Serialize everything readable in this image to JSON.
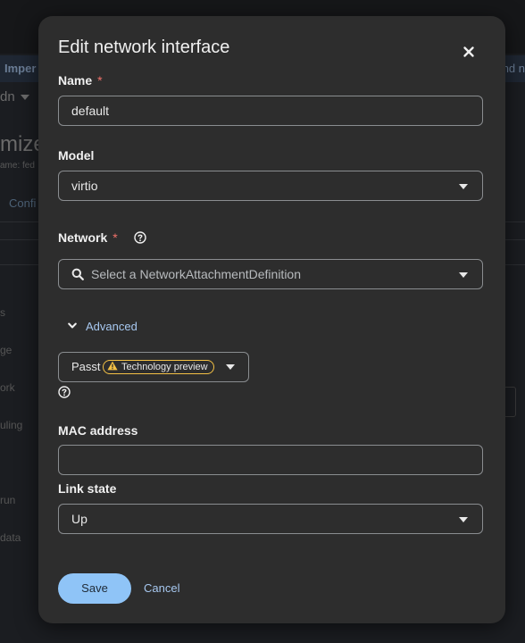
{
  "background": {
    "strip_left": "Imper",
    "strip_right": "nd n",
    "project_selector": "dn",
    "title_fragment": "mize",
    "subtitle_fragment": "ame: fed",
    "tab_fragment": "Confi",
    "side_items": [
      "s",
      "ge",
      "ork",
      "uling",
      "run",
      "data"
    ]
  },
  "modal": {
    "title": "Edit network interface",
    "close_icon": "close-icon",
    "name": {
      "label": "Name",
      "required_marker": "*",
      "value": "default"
    },
    "model": {
      "label": "Model",
      "value": "virtio"
    },
    "network": {
      "label": "Network",
      "required_marker": "*",
      "help_icon": "help-icon",
      "placeholder": "Select a NetworkAttachmentDefinition"
    },
    "advanced": {
      "toggle_label": "Advanced",
      "binding_value": "Passt",
      "badge_label": "Technology preview",
      "badge_icon": "warning-icon"
    },
    "mac_address": {
      "label": "MAC address",
      "value": ""
    },
    "link_state": {
      "label": "Link state",
      "value": "Up"
    },
    "actions": {
      "save": "Save",
      "cancel": "Cancel"
    }
  },
  "colors": {
    "modal_bg": "#2d2d2d",
    "primary_button": "#8fc4f7",
    "link": "#a7c8f0",
    "required": "#f0716a",
    "badge_border": "#f4c145"
  }
}
